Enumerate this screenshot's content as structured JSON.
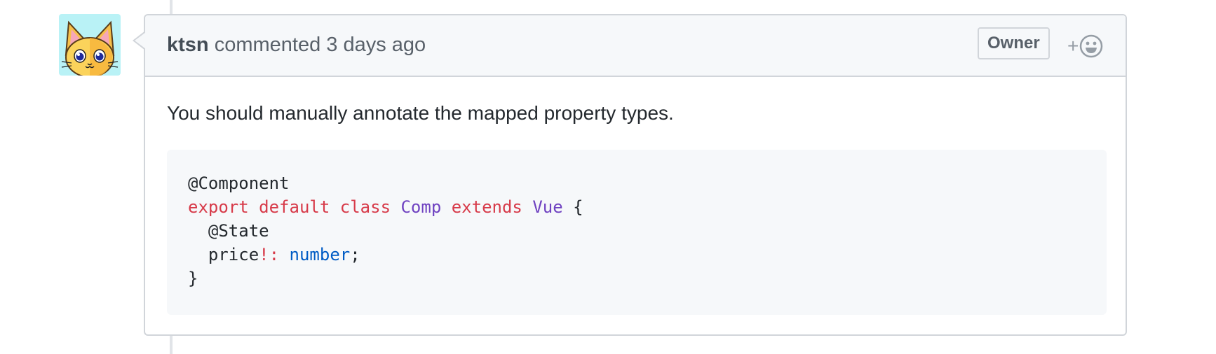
{
  "comment": {
    "author": "ktsn",
    "action": "commented",
    "timestamp": "3 days ago",
    "badge": "Owner",
    "reaction_plus": "+",
    "body": "You should manually annotate the mapped property types.",
    "code": {
      "line1": "@Component",
      "line2": {
        "kw_export": "export",
        "kw_default": "default",
        "kw_class": "class",
        "class_name": "Comp",
        "kw_extends": "extends",
        "base_class": "Vue",
        "brace_open": "{"
      },
      "line3": "@State",
      "line4": {
        "prop": "price",
        "op": "!:",
        "type": "number",
        "semicolon": ";"
      },
      "line5": "}"
    }
  },
  "icons": {
    "avatar": "cat-avatar-icon",
    "reaction": "smiley-icon"
  },
  "colors": {
    "keyword": "#d73a49",
    "entity": "#6f42c1",
    "type": "#005cc5",
    "border": "#d1d5da",
    "header_bg": "#f6f8fa",
    "avatar_bg": "#b9f2f6"
  }
}
